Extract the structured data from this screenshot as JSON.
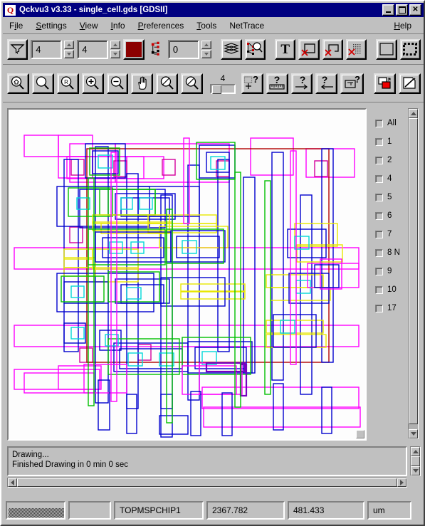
{
  "window": {
    "title": "Qckvu3 v3.33 - single_cell.gds [GDSII]",
    "icon": "Q",
    "minimize_label": "minimize-icon",
    "maximize_label": "maximize-icon",
    "close_label": "✕"
  },
  "menu": {
    "items": [
      {
        "label": "File",
        "mnemonic": "i"
      },
      {
        "label": "Settings",
        "mnemonic": "S"
      },
      {
        "label": "View",
        "mnemonic": "V"
      },
      {
        "label": "Info",
        "mnemonic": "I"
      },
      {
        "label": "Preferences",
        "mnemonic": "P"
      },
      {
        "label": "Tools",
        "mnemonic": "T"
      },
      {
        "label": "NetTrace",
        "mnemonic": ""
      }
    ],
    "help": {
      "label": "Help",
      "mnemonic": "H"
    }
  },
  "toolbar1": {
    "funnel_button": "filter-funnel",
    "spin1_value": "4",
    "spin2_value": "4",
    "color_swatch": "#8b0000",
    "hier_spin_value": "0",
    "layers_button": "layers-stack",
    "hier_search_button": "hierarchy-search",
    "text_button": "T",
    "no_box_button": "hide-box",
    "no_path_button": "hide-path",
    "no_fill_button": "hide-fill",
    "outline_button": "outline-box",
    "dashed_button": "dashed-box"
  },
  "toolbar2": {
    "zoom_home_button": "zoom-home",
    "zoom_full_button": "zoom-full",
    "zoom_prev_button": "zoom-previous",
    "zoom_in_button": "zoom-in",
    "zoom_out_button": "zoom-out",
    "pan_button": "pan-hand",
    "zoom_slash1_button": "zoom-disabled-1",
    "zoom_slash2_button": "zoom-disabled-2",
    "slider_value": "4",
    "query_select_button": "query-select",
    "query_measure_button": "query-measure",
    "query_next_button": "query-next",
    "query_prev_button": "query-previous",
    "query_area_button": "query-area",
    "layer_color_button": "layer-color",
    "edit_button": "edit-page"
  },
  "layers": {
    "items": [
      {
        "label": "All",
        "checked": false
      },
      {
        "label": "1",
        "checked": false
      },
      {
        "label": "2",
        "checked": false
      },
      {
        "label": "4",
        "checked": false
      },
      {
        "label": "5",
        "checked": false
      },
      {
        "label": "6",
        "checked": false
      },
      {
        "label": "7",
        "checked": false
      },
      {
        "label": "8 N",
        "checked": false
      },
      {
        "label": "9",
        "checked": false
      },
      {
        "label": "10",
        "checked": false
      },
      {
        "label": "17",
        "checked": false
      }
    ]
  },
  "messages": {
    "line1": "Drawing...",
    "line2": "Finished Drawing in 0 min 0 sec"
  },
  "status": {
    "progress_label": "",
    "empty_label": "",
    "cell_name": "TOPMSPCHIP1",
    "x_coord": "2367.782",
    "y_coord": "481.433",
    "units": "um"
  },
  "canvas": {
    "background": "#fdfdfd",
    "palette": {
      "blue": "#0000cd",
      "magenta": "#ff00ff",
      "green": "#00c000",
      "cyan": "#00d8d8",
      "yellow": "#e8e800",
      "red": "#b00000",
      "darkblue": "#000080",
      "crimson": "#c00060"
    }
  }
}
